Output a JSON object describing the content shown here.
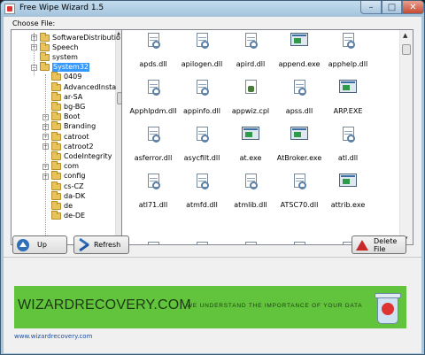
{
  "window": {
    "title": "Free Wipe Wizard 1.5",
    "controls": {
      "minimize": "–",
      "maximize": "□",
      "close": "✕"
    }
  },
  "choose_label": "Choose File:",
  "tree": {
    "expander_plus": "+",
    "expander_minus": "−",
    "items": [
      {
        "label": "SoftwareDistributio",
        "expander": "plus",
        "level": 1
      },
      {
        "label": "Speech",
        "expander": "plus",
        "level": 1
      },
      {
        "label": "system",
        "expander": "none",
        "level": 1
      },
      {
        "label": "System32",
        "expander": "minus",
        "level": 1,
        "selected": true
      },
      {
        "label": "0409",
        "expander": "none",
        "level": 2
      },
      {
        "label": "AdvancedInsta",
        "expander": "none",
        "level": 2
      },
      {
        "label": "ar-SA",
        "expander": "none",
        "level": 2
      },
      {
        "label": "bg-BG",
        "expander": "none",
        "level": 2
      },
      {
        "label": "Boot",
        "expander": "plus",
        "level": 2
      },
      {
        "label": "Branding",
        "expander": "plus",
        "level": 2
      },
      {
        "label": "catroot",
        "expander": "plus",
        "level": 2
      },
      {
        "label": "catroot2",
        "expander": "plus",
        "level": 2
      },
      {
        "label": "CodeIntegrity",
        "expander": "none",
        "level": 2
      },
      {
        "label": "com",
        "expander": "plus",
        "level": 2
      },
      {
        "label": "config",
        "expander": "plus",
        "level": 2
      },
      {
        "label": "cs-CZ",
        "expander": "none",
        "level": 2
      },
      {
        "label": "da-DK",
        "expander": "none",
        "level": 2
      },
      {
        "label": "de",
        "expander": "none",
        "level": 2
      },
      {
        "label": "de-DE",
        "expander": "none",
        "level": 2
      }
    ]
  },
  "files": [
    {
      "name": "apds.dll",
      "type": "dll"
    },
    {
      "name": "apilogen.dll",
      "type": "dll"
    },
    {
      "name": "apird.dll",
      "type": "dll"
    },
    {
      "name": "append.exe",
      "type": "exe"
    },
    {
      "name": "apphelp.dll",
      "type": "dll"
    },
    {
      "name": "Apphlpdm.dll",
      "type": "dll"
    },
    {
      "name": "appinfo.dll",
      "type": "dll"
    },
    {
      "name": "appwiz.cpl",
      "type": "cpl"
    },
    {
      "name": "apss.dll",
      "type": "dll"
    },
    {
      "name": "ARP.EXE",
      "type": "exe"
    },
    {
      "name": "asferror.dll",
      "type": "dll"
    },
    {
      "name": "asycfilt.dll",
      "type": "dll"
    },
    {
      "name": "at.exe",
      "type": "exe"
    },
    {
      "name": "AtBroker.exe",
      "type": "exe"
    },
    {
      "name": "atl.dll",
      "type": "dll"
    },
    {
      "name": "atl71.dll",
      "type": "dll"
    },
    {
      "name": "atmfd.dll",
      "type": "dll"
    },
    {
      "name": "atmlib.dll",
      "type": "dll"
    },
    {
      "name": "ATSC70.dll",
      "type": "dll"
    },
    {
      "name": "attrib.exe",
      "type": "exe"
    }
  ],
  "buttons": {
    "up": "Up",
    "refresh": "Refresh",
    "delete": "Delete File"
  },
  "banner": {
    "brand": "WIZARDRECOVERY.COM",
    "slogan": "WE UNDERSTAND THE IMPORTANCE OF YOUR DATA",
    "color": "#62c43c"
  },
  "website": "www.wizardrecovery.com",
  "icons": [
    "app-icon",
    "folder-icon",
    "dll-file-icon",
    "exe-file-icon",
    "cpl-file-icon",
    "up-arrow-icon",
    "refresh-icon",
    "delete-warning-icon",
    "recycle-bin-icon"
  ]
}
